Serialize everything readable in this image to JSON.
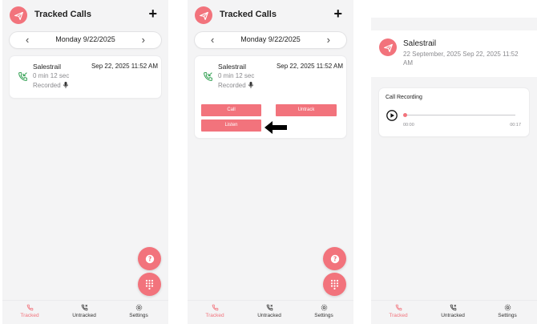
{
  "app": {
    "title": "Tracked Calls"
  },
  "date_selector": {
    "label": "Monday 9/22/2025"
  },
  "call": {
    "name": "Salestrail",
    "datetime": "Sep 22, 2025 11:52 AM",
    "duration": "0 min 12 sec",
    "status": "Recorded"
  },
  "actions": {
    "call": "Call",
    "untrack": "Untrack",
    "listen": "Listen"
  },
  "navbar": {
    "tracked": "Tracked",
    "untracked": "Untracked",
    "settings": "Settings"
  },
  "detail": {
    "name": "Salestrail",
    "date_line": "22 September, 2025 Sep 22, 2025 11:52 AM",
    "recording": {
      "title": "Call Recording",
      "current_time": "00:00",
      "total_time": "00:17",
      "progress": 0
    }
  },
  "colors": {
    "accent": "#f2737c",
    "green": "#2e9e4f"
  },
  "icons": {
    "logo": "paper-plane-icon",
    "add": "plus-icon",
    "prev": "chevron-left-icon",
    "next": "chevron-right-icon",
    "incoming": "incoming-call-icon",
    "mic": "mic-icon",
    "help": "help-icon",
    "dialpad": "dialpad-icon",
    "arrow": "arrow-left-icon",
    "play": "play-icon"
  }
}
